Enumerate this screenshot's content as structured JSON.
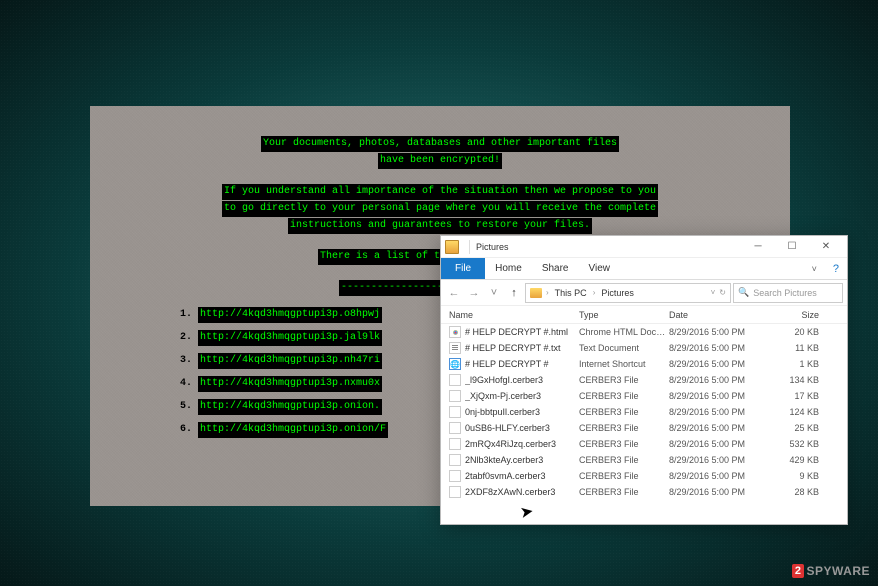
{
  "ransom": {
    "line1": "Your documents, photos, databases and other important files",
    "line2": "have been encrypted!",
    "line3": "If you understand all importance of the situation then we propose to you",
    "line4": "to go directly to your personal page where you will receive the complete",
    "line5": "instructions and guarantees to restore your files.",
    "line6": "There is a list of temporary addresses t",
    "dashes": "---------------------------------",
    "links": [
      {
        "num": "1.",
        "url": "http://4kqd3hmqgptupi3p.o8hpwj"
      },
      {
        "num": "2.",
        "url": "http://4kqd3hmqgptupi3p.jal9lk"
      },
      {
        "num": "3.",
        "url": "http://4kqd3hmqgptupi3p.nh47ri"
      },
      {
        "num": "4.",
        "url": "http://4kqd3hmqgptupi3p.nxmu0x"
      },
      {
        "num": "5.",
        "url": "http://4kqd3hmqgptupi3p.onion."
      },
      {
        "num": "6.",
        "url": "http://4kqd3hmqgptupi3p.onion/F"
      }
    ]
  },
  "explorer": {
    "title": "Pictures",
    "ribbon": {
      "file": "File",
      "home": "Home",
      "share": "Share",
      "view": "View"
    },
    "address": {
      "root": "This PC",
      "folder": "Pictures"
    },
    "search_placeholder": "Search Pictures",
    "columns": {
      "name": "Name",
      "type": "Type",
      "date": "Date",
      "size": "Size"
    },
    "files": [
      {
        "icon": "html",
        "name": "# HELP DECRYPT #.html",
        "type": "Chrome HTML Docu…",
        "date": "8/29/2016 5:00 PM",
        "size": "20 KB"
      },
      {
        "icon": "txt",
        "name": "# HELP DECRYPT #.txt",
        "type": "Text Document",
        "date": "8/29/2016 5:00 PM",
        "size": "11 KB"
      },
      {
        "icon": "url",
        "name": "# HELP DECRYPT #",
        "type": "Internet Shortcut",
        "date": "8/29/2016 5:00 PM",
        "size": "1 KB"
      },
      {
        "icon": "blank",
        "name": "_l9GxHofgI.cerber3",
        "type": "CERBER3 File",
        "date": "8/29/2016 5:00 PM",
        "size": "134 KB"
      },
      {
        "icon": "blank",
        "name": "_XjQxm-Pj.cerber3",
        "type": "CERBER3 File",
        "date": "8/29/2016 5:00 PM",
        "size": "17 KB"
      },
      {
        "icon": "blank",
        "name": "0nj-bbtpuIl.cerber3",
        "type": "CERBER3 File",
        "date": "8/29/2016 5:00 PM",
        "size": "124 KB"
      },
      {
        "icon": "blank",
        "name": "0uSB6-HLFY.cerber3",
        "type": "CERBER3 File",
        "date": "8/29/2016 5:00 PM",
        "size": "25 KB"
      },
      {
        "icon": "blank",
        "name": "2mRQx4RiJzq.cerber3",
        "type": "CERBER3 File",
        "date": "8/29/2016 5:00 PM",
        "size": "532 KB"
      },
      {
        "icon": "blank",
        "name": "2Nlb3kteAy.cerber3",
        "type": "CERBER3 File",
        "date": "8/29/2016 5:00 PM",
        "size": "429 KB"
      },
      {
        "icon": "blank",
        "name": "2tabf0svmA.cerber3",
        "type": "CERBER3 File",
        "date": "8/29/2016 5:00 PM",
        "size": "9 KB"
      },
      {
        "icon": "blank",
        "name": "2XDF8zXAwN.cerber3",
        "type": "CERBER3 File",
        "date": "8/29/2016 5:00 PM",
        "size": "28 KB"
      }
    ]
  },
  "watermark": {
    "two": "2",
    "text": "SPYWARE"
  }
}
